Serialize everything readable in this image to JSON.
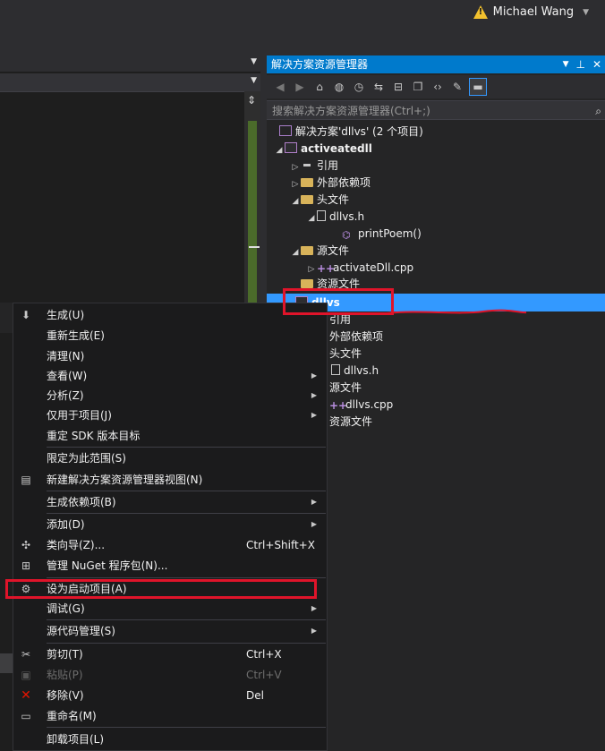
{
  "user": {
    "name": "Michael Wang",
    "warning_icon": "warning-icon",
    "dropdown_icon": "chevron-down-icon"
  },
  "solution_explorer": {
    "title": "解决方案资源管理器",
    "search_placeholder": "搜索解决方案资源管理器(Ctrl+;)",
    "toolbar_icons": [
      "back-icon",
      "forward-icon",
      "home-icon",
      "globe-icon",
      "history-icon",
      "sync-icon",
      "collapse-all-icon",
      "show-all-files-icon",
      "view-code-icon",
      "properties-icon",
      "preview-icon"
    ],
    "tree": [
      {
        "label": "解决方案'dllvs' (2 个项目)",
        "icon": "solution-icon"
      },
      {
        "label": "activeatedll",
        "icon": "project-icon"
      },
      {
        "label": "引用",
        "icon": "references-icon"
      },
      {
        "label": "外部依赖项",
        "icon": "folder-icon"
      },
      {
        "label": "头文件",
        "icon": "folder-icon"
      },
      {
        "label": "dllvs.h",
        "icon": "header-file-icon"
      },
      {
        "label": "printPoem()",
        "icon": "function-icon"
      },
      {
        "label": "源文件",
        "icon": "folder-icon"
      },
      {
        "label": "activateDll.cpp",
        "icon": "cpp-file-icon"
      },
      {
        "label": "资源文件",
        "icon": "folder-icon"
      },
      {
        "label": "dllvs",
        "icon": "project-icon"
      },
      {
        "label": "引用",
        "icon": "references-icon"
      },
      {
        "label": "外部依赖项",
        "icon": "folder-icon"
      },
      {
        "label": "头文件",
        "icon": "folder-icon"
      },
      {
        "label": "dllvs.h",
        "icon": "header-file-icon"
      },
      {
        "label": "源文件",
        "icon": "folder-icon"
      },
      {
        "label": "dllvs.cpp",
        "icon": "cpp-file-icon"
      },
      {
        "label": "资源文件",
        "icon": "folder-icon"
      }
    ]
  },
  "context_menu": [
    {
      "label": "生成(U)",
      "icon": "build-icon"
    },
    {
      "label": "重新生成(E)"
    },
    {
      "label": "清理(N)"
    },
    {
      "label": "查看(W)",
      "submenu": true
    },
    {
      "label": "分析(Z)",
      "submenu": true
    },
    {
      "label": "仅用于项目(J)",
      "submenu": true
    },
    {
      "label": "重定 SDK 版本目标"
    },
    {
      "label": "限定为此范围(S)"
    },
    {
      "label": "新建解决方案资源管理器视图(N)",
      "icon": "new-view-icon"
    },
    {
      "label": "生成依赖项(B)",
      "submenu": true
    },
    {
      "label": "添加(D)",
      "submenu": true
    },
    {
      "label": "类向导(Z)...",
      "shortcut": "Ctrl+Shift+X",
      "icon": "class-wizard-icon"
    },
    {
      "label": "管理 NuGet 程序包(N)...",
      "icon": "nuget-icon"
    },
    {
      "label": "设为启动项目(A)",
      "icon": "gear-icon"
    },
    {
      "label": "调试(G)",
      "submenu": true
    },
    {
      "label": "源代码管理(S)",
      "submenu": true
    },
    {
      "label": "剪切(T)",
      "shortcut": "Ctrl+X",
      "icon": "scissors-icon"
    },
    {
      "label": "粘贴(P)",
      "shortcut": "Ctrl+V",
      "icon": "paste-icon",
      "disabled": true
    },
    {
      "label": "移除(V)",
      "shortcut": "Del",
      "icon": "remove-icon"
    },
    {
      "label": "重命名(M)",
      "icon": "rename-icon"
    },
    {
      "label": "卸载项目(L)"
    }
  ],
  "colors": {
    "accent": "#007acc",
    "selection": "#3399ff",
    "annotation_red": "#e0142a"
  }
}
